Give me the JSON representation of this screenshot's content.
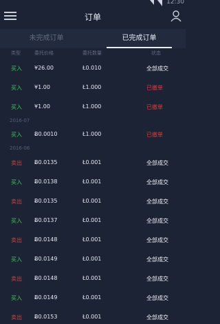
{
  "status_bar": {
    "time": "12:30"
  },
  "header": {
    "title": "订单"
  },
  "tabs": [
    {
      "label": "未完成订单"
    },
    {
      "label": "已完成订单"
    }
  ],
  "columns": {
    "type": "类型",
    "price": "委托价格",
    "amount": "委托数量",
    "status": "状态"
  },
  "sections": [
    {
      "label": "2016-07"
    },
    {
      "label": "2016-06"
    }
  ],
  "orders": [
    {
      "type": "买入",
      "side": "buy",
      "price": "¥26.00",
      "amount": "Ł0.010",
      "status": "全部成交",
      "state": "ok"
    },
    {
      "type": "买入",
      "side": "buy",
      "price": "¥1.00",
      "amount": "Ł1.000",
      "status": "已撤单",
      "state": "cancel"
    },
    {
      "type": "买入",
      "side": "buy",
      "price": "¥1.00",
      "amount": "Ł1.000",
      "status": "已撤单",
      "state": "cancel"
    },
    {
      "type": "买入",
      "side": "buy",
      "price": "Ƀ0.0010",
      "amount": "Ł1.000",
      "status": "已撤单",
      "state": "cancel"
    },
    {
      "type": "卖出",
      "side": "sell",
      "price": "Ƀ0.0135",
      "amount": "Ł0.001",
      "status": "全部成交",
      "state": "ok"
    },
    {
      "type": "买入",
      "side": "buy",
      "price": "Ƀ0.0138",
      "amount": "Ł0.001",
      "status": "全部成交",
      "state": "ok"
    },
    {
      "type": "卖出",
      "side": "sell",
      "price": "Ƀ0.0135",
      "amount": "Ł0.001",
      "status": "全部成交",
      "state": "ok"
    },
    {
      "type": "买入",
      "side": "buy",
      "price": "Ƀ0.0137",
      "amount": "Ł0.001",
      "status": "全部成交",
      "state": "ok"
    },
    {
      "type": "卖出",
      "side": "sell",
      "price": "Ƀ0.0148",
      "amount": "Ł0.001",
      "status": "全部成交",
      "state": "ok"
    },
    {
      "type": "买入",
      "side": "buy",
      "price": "Ƀ0.0149",
      "amount": "Ł0.001",
      "status": "全部成交",
      "state": "ok"
    },
    {
      "type": "卖出",
      "side": "sell",
      "price": "Ƀ0.0148",
      "amount": "Ł0.001",
      "status": "全部成交",
      "state": "ok"
    },
    {
      "type": "买入",
      "side": "buy",
      "price": "Ƀ0.0149",
      "amount": "Ł0.001",
      "status": "全部成交",
      "state": "ok"
    },
    {
      "type": "卖出",
      "side": "sell",
      "price": "Ƀ0.0153",
      "amount": "Ł0.001",
      "status": "全部成交",
      "state": "ok"
    }
  ],
  "colors": {
    "background": "#1c2334",
    "buy": "#3fc25a",
    "sell": "#e23a3a",
    "cancelled": "#e23a3a"
  }
}
